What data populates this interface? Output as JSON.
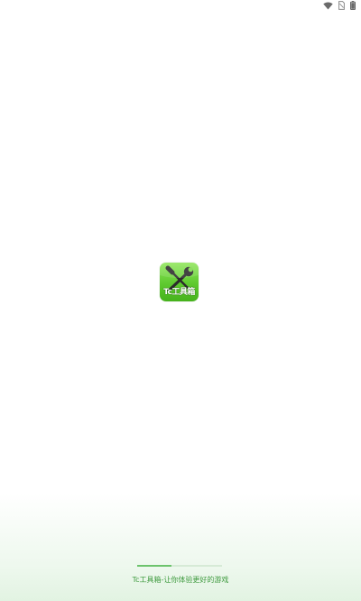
{
  "status_bar": {
    "icons": [
      "wifi-icon",
      "no-sim-icon",
      "battery-icon"
    ]
  },
  "splash": {
    "icon_name": "wrench-screwdriver-icon",
    "icon_label": "Tc工具箱",
    "icon_bg_color": "#5ec92f"
  },
  "loading": {
    "progress_percent": 40,
    "track_color": "#d6ead6",
    "fill_color": "#6cc36c"
  },
  "footer": {
    "tagline": "Tc工具箱-让你体验更好的游戏",
    "text_color": "#3e9a3e"
  }
}
